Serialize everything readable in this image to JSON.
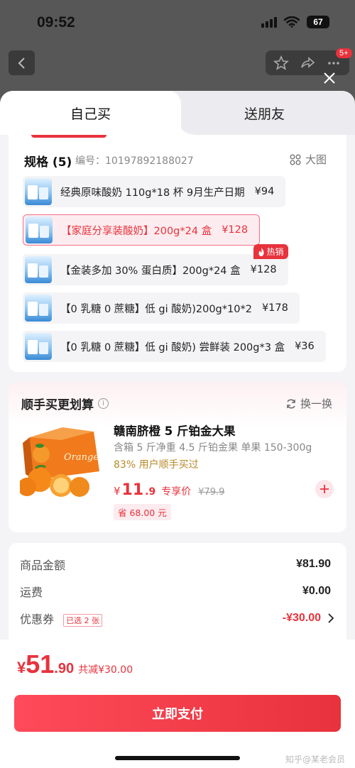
{
  "status_bar": {
    "time": "09:52",
    "battery": "67"
  },
  "header": {
    "badge": "5+"
  },
  "tabs": {
    "self": "自己买",
    "gift": "送朋友"
  },
  "spec": {
    "title": "规格 (5)",
    "code": "编号：10197892188027",
    "big_image": "大图",
    "options": [
      {
        "label": "经典原味酸奶 110g*18 杯 9月生产日期",
        "price": "¥94"
      },
      {
        "label": "【家庭分享装酸奶】200g*24 盒",
        "price": "¥128",
        "selected": true
      },
      {
        "label": "【金装多加 30% 蛋白质】200g*24 盒",
        "price": "¥128",
        "tag": "热销"
      },
      {
        "label": "【0 乳糖 0 蔗糖】低 gi 酸奶)200g*10*2",
        "price": "¥178"
      },
      {
        "label": "【0 乳糖 0 蔗糖】低 gi 酸奶) 尝鲜装 200g*3 盒",
        "price": "¥36"
      }
    ]
  },
  "upsell": {
    "title": "顺手买更划算",
    "swap": "换一换",
    "product_name": "赣南脐橙 5 斤铂金大果",
    "desc": "含箱 5 斤净重 4.5 斤铂金果 单果 150-300g",
    "users": "83% 用户顺手买过",
    "price_yen": "¥",
    "price_int": "11",
    "price_dec": ".9",
    "price_label": "专享价",
    "orig_price": "¥79.9",
    "save": "省 68.00 元",
    "box_text": "Orange"
  },
  "summary": {
    "goods_label": "商品金额",
    "goods_value": "¥81.90",
    "shipping_label": "运费",
    "shipping_value": "¥0.00",
    "coupon_label": "优惠券",
    "coupon_tag": "已选 2 张",
    "coupon_value": "-¥30.00"
  },
  "footer": {
    "yen": "¥",
    "total_int": "51",
    "total_dec": ".90",
    "saved": "共减¥30.00",
    "pay_label": "立即支付",
    "watermark": "知乎@某老会员"
  },
  "colors": {
    "accent": "#e8323c",
    "gold": "#b98a2a"
  }
}
